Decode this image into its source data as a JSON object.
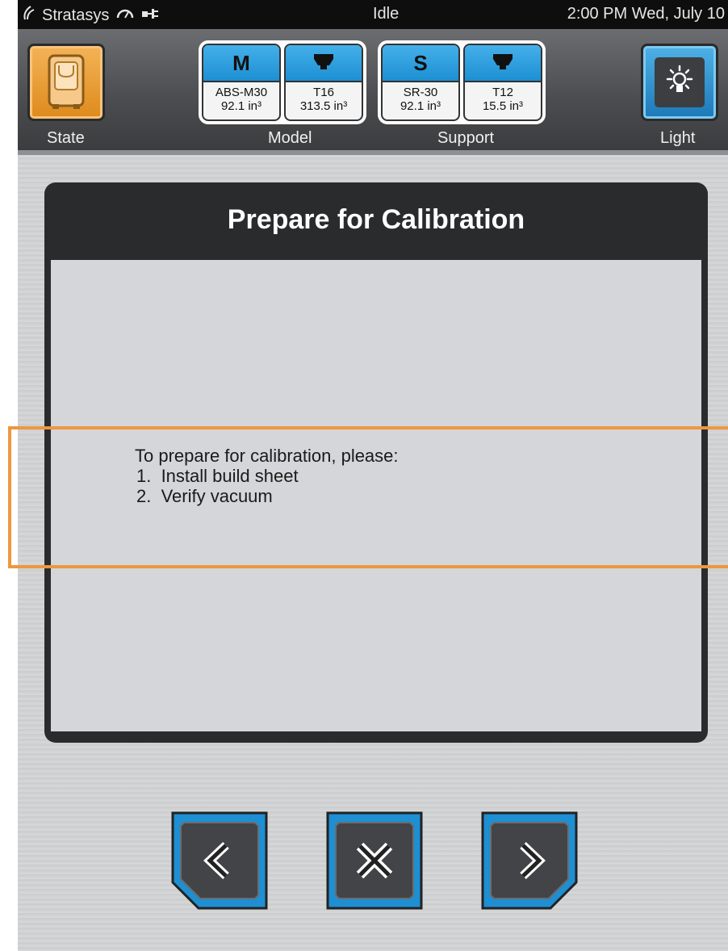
{
  "status_bar": {
    "brand": "Stratasys",
    "state": "Idle",
    "clock": "2:00 PM Wed, July 10"
  },
  "header": {
    "state_label": "State",
    "light_label": "Light",
    "model_label": "Model",
    "support_label": "Support",
    "model_slots": [
      {
        "tab": "M",
        "name": "ABS-M30",
        "volume": "92.1 in³"
      },
      {
        "tab": "",
        "tab_icon": "tip-icon",
        "name": "T16",
        "volume": "313.5 in³"
      }
    ],
    "support_slots": [
      {
        "tab": "S",
        "name": "SR-30",
        "volume": "92.1 in³"
      },
      {
        "tab": "",
        "tab_icon": "tip-icon",
        "name": "T12",
        "volume": "15.5 in³"
      }
    ]
  },
  "dialog": {
    "title": "Prepare for Calibration",
    "intro": "To prepare for calibration, please:",
    "steps": [
      "1.  Install build sheet",
      "2.  Verify vacuum"
    ]
  },
  "nav": {
    "back_icon": "chevron-left-icon",
    "cancel_icon": "close-icon",
    "next_icon": "chevron-right-icon"
  },
  "colors": {
    "accent_blue": "#1d8fd2",
    "state_orange": "#de8a1c",
    "highlight_orange": "#ee9740",
    "dialog_dark": "#2a2b2d"
  }
}
